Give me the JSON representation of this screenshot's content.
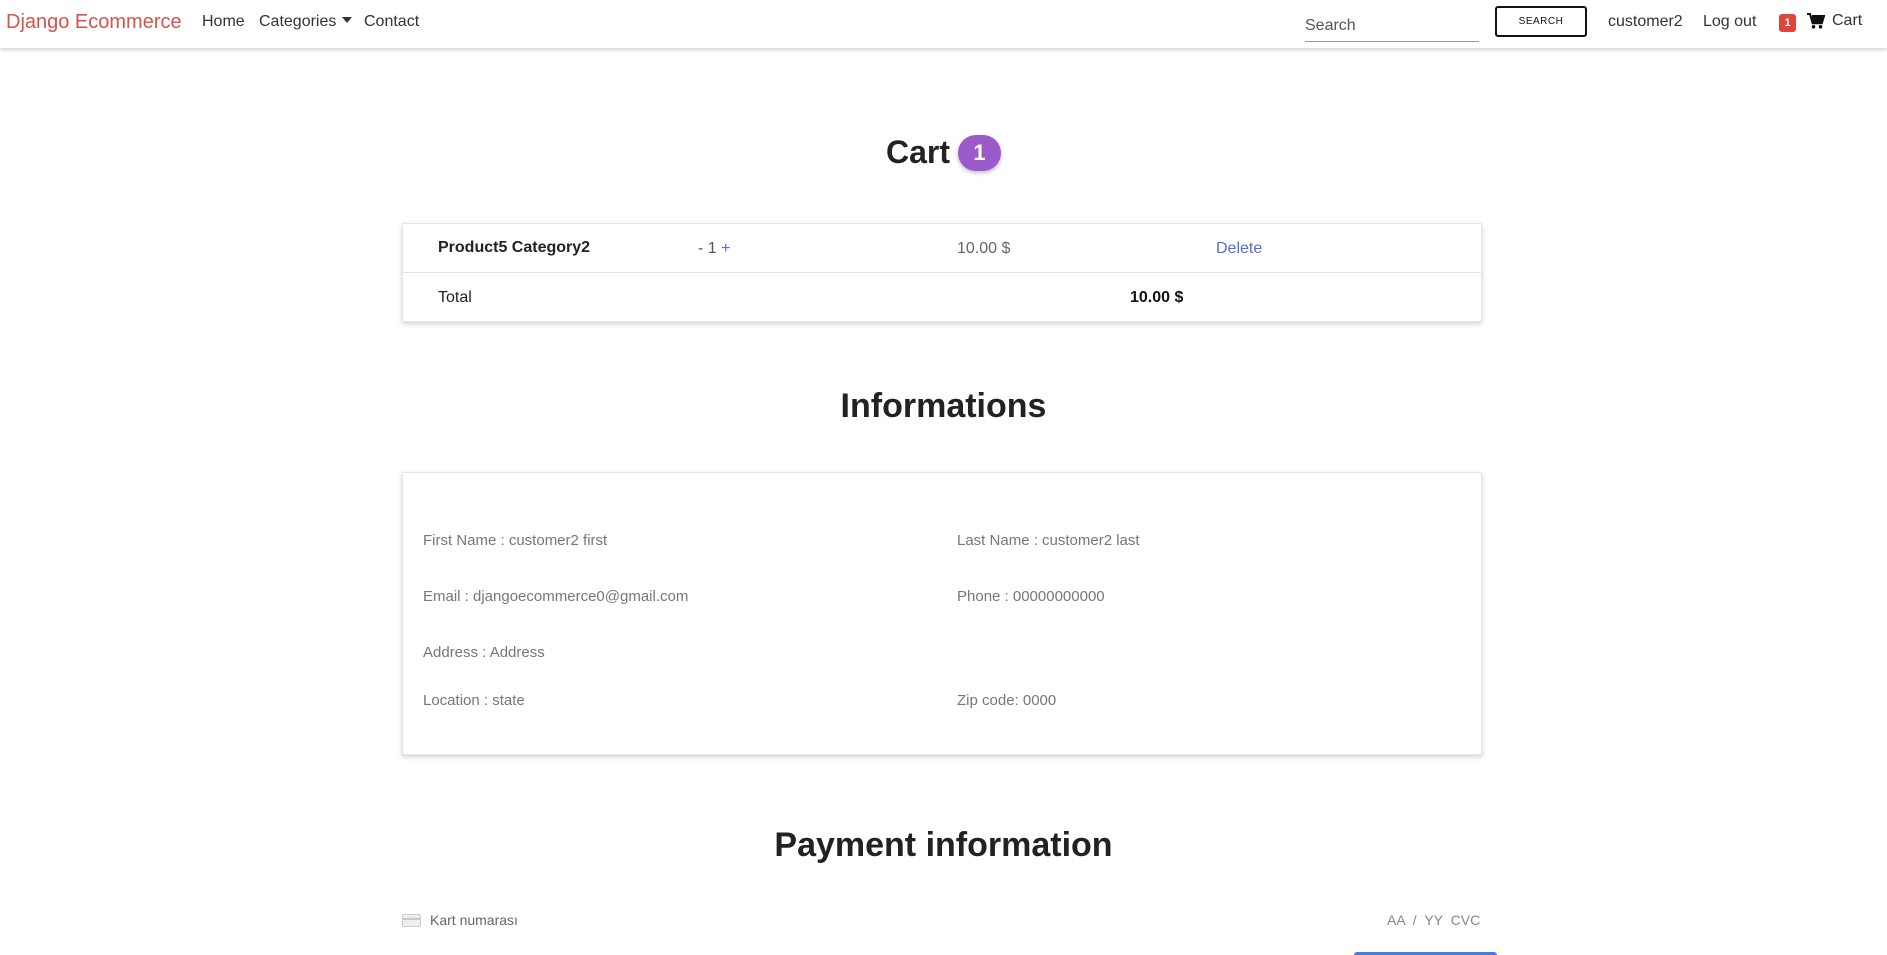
{
  "navbar": {
    "brand": "Django Ecommerce",
    "links": {
      "home": "Home",
      "categories": "Categories",
      "contact": "Contact"
    },
    "search": {
      "placeholder": "Search",
      "button": "SEARCH"
    },
    "user": "customer2",
    "logout": "Log out",
    "cart_count": "1",
    "cart_label": "Cart"
  },
  "cart": {
    "title": "Cart",
    "count": "1",
    "items": [
      {
        "name": "Product5 Category2",
        "qty_minus": "-",
        "quantity": "1",
        "qty_plus": "+",
        "price": "10.00 $",
        "delete": "Delete"
      }
    ],
    "total_label": "Total",
    "total_value": "10.00 $"
  },
  "informations": {
    "title": "Informations",
    "first_name": "First Name : customer2 first",
    "last_name": "Last Name : customer2 last",
    "email": "Email : djangoecommerce0@gmail.com",
    "phone": "Phone : 00000000000",
    "address": "Address : Address",
    "location": "Location : state",
    "zip": "Zip code: 0000"
  },
  "payment": {
    "title": "Payment information",
    "card_number_placeholder": "Kart numarası",
    "expiry_cvc_placeholder": "AA / YY  CVC"
  },
  "colors": {
    "brand": "#d2554b",
    "badge_purple": "#9b59c9",
    "link_blue": "#5570c9",
    "cart_badge_red": "#e0453b"
  }
}
